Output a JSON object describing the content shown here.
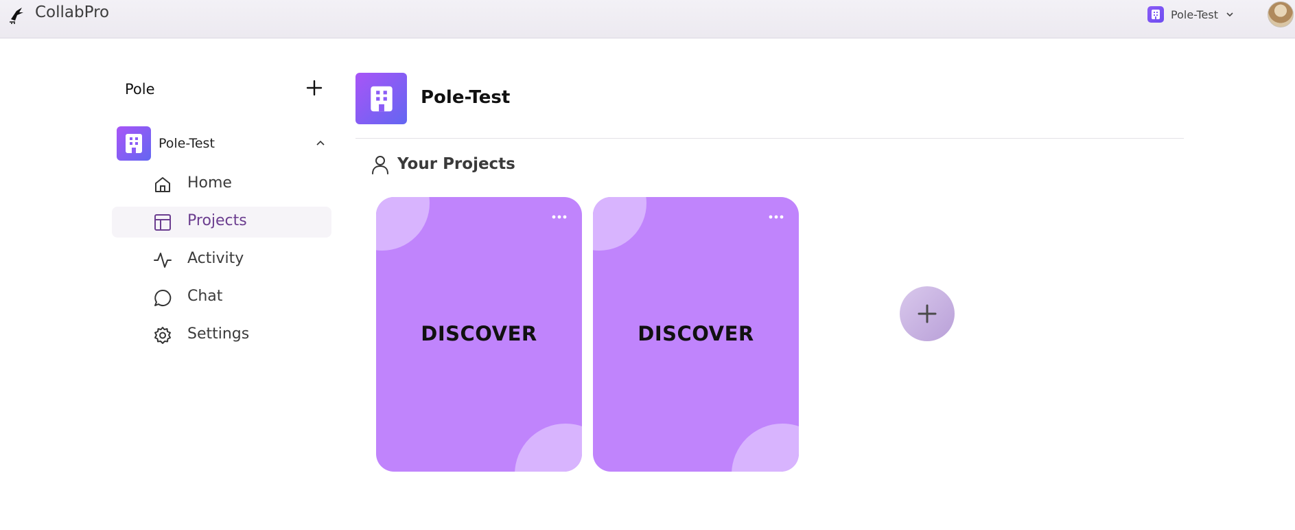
{
  "app": {
    "title": "CollabPro"
  },
  "header": {
    "workspace": "Pole-Test"
  },
  "sidebar": {
    "heading": "Pole",
    "org": {
      "label": "Pole-Test"
    },
    "items": [
      {
        "label": "Home",
        "icon": "home-icon"
      },
      {
        "label": "Projects",
        "icon": "layout-icon",
        "active": true
      },
      {
        "label": "Activity",
        "icon": "activity-icon"
      },
      {
        "label": "Chat",
        "icon": "chat-icon"
      },
      {
        "label": "Settings",
        "icon": "gear-icon"
      }
    ]
  },
  "main": {
    "title": "Pole-Test",
    "section_title": "Your Projects",
    "projects": [
      {
        "label": "DISCOVER"
      },
      {
        "label": "DISCOVER"
      }
    ]
  },
  "colors": {
    "accent": "#8b5cf6",
    "card": "#c084fc",
    "card_blob": "#d8b4fe",
    "active_text": "#6b3d8f"
  }
}
